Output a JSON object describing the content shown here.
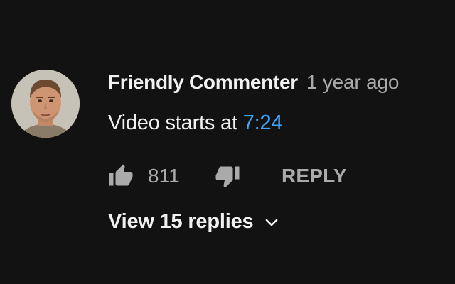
{
  "comment": {
    "author_name": "Friendly Commenter",
    "timestamp": "1 year ago",
    "text_prefix": "Video starts at ",
    "time_link": "7:24",
    "like_count": "811",
    "reply_label": "REPLY",
    "view_replies_label": "View 15 replies"
  },
  "icons": {
    "like": "thumbs-up-icon",
    "dislike": "thumbs-down-icon",
    "expand": "chevron-down-icon"
  },
  "colors": {
    "background": "#121212",
    "primary_text": "#f1f1f1",
    "secondary_text": "#aaaaaa",
    "link": "#3ea6ff"
  }
}
